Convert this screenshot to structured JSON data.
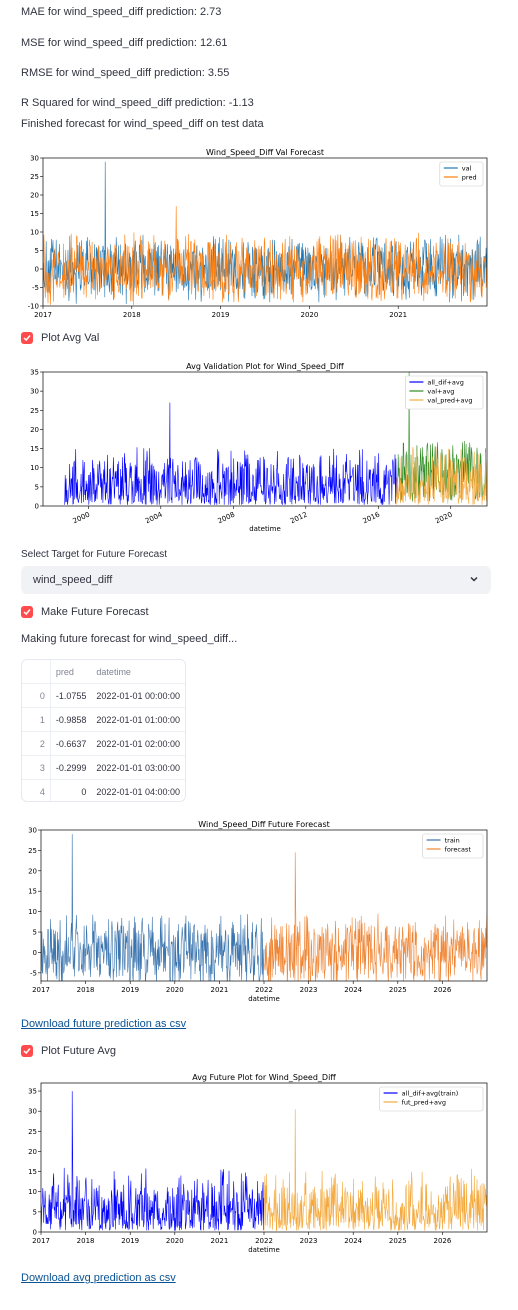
{
  "metrics": {
    "mae": "MAE for wind_speed_diff prediction: 2.73",
    "mse": "MSE for wind_speed_diff prediction: 12.61",
    "rmse": "RMSE for wind_speed_diff prediction: 3.55",
    "r2": "R Squared for wind_speed_diff prediction: -1.13",
    "finished": "Finished forecast for wind_speed_diff on test data"
  },
  "checkboxes": {
    "plot_avg_val": "Plot Avg Val",
    "make_future": "Make Future Forecast",
    "plot_future_avg": "Plot Future Avg"
  },
  "select": {
    "label": "Select Target for Future Forecast",
    "value": "wind_speed_diff"
  },
  "making_text": "Making future forecast for wind_speed_diff...",
  "table": {
    "columns": [
      "",
      "pred",
      "datetime"
    ],
    "rows": [
      [
        "0",
        "-1.0755",
        "2022-01-01 00:00:00"
      ],
      [
        "1",
        "-0.9858",
        "2022-01-01 01:00:00"
      ],
      [
        "2",
        "-0.6637",
        "2022-01-01 02:00:00"
      ],
      [
        "3",
        "-0.2999",
        "2022-01-01 03:00:00"
      ],
      [
        "4",
        "0",
        "2022-01-01 04:00:00"
      ]
    ]
  },
  "links": {
    "download_future": "Download future prediction as csv",
    "download_avg": "Download avg prediction as csv"
  },
  "chart_data": [
    {
      "type": "line",
      "title": "Wind_Speed_Diff Val Forecast",
      "xlabel": "",
      "xticks": [
        "2017",
        "2018",
        "2019",
        "2020",
        "2021"
      ],
      "xlim": [
        2017,
        2022
      ],
      "ylim": [
        -10,
        30
      ],
      "yticks": [
        -10,
        -5,
        0,
        5,
        10,
        15,
        20,
        25,
        30
      ],
      "legend": "top-right",
      "series": [
        {
          "name": "val",
          "color": "#1f77b4",
          "x_range": [
            2017,
            2022
          ],
          "spikes": [
            [
              2017.7,
              29
            ]
          ]
        },
        {
          "name": "pred",
          "color": "#ff7f0e",
          "x_range": [
            2017,
            2022
          ],
          "spikes": [
            [
              2018.5,
              17
            ]
          ]
        }
      ]
    },
    {
      "type": "line",
      "title": "Avg Validation Plot for Wind_Speed_Diff",
      "xlabel": "datetime",
      "xticks": [
        "2000",
        "2004",
        "2008",
        "2012",
        "2016",
        "2020"
      ],
      "xlim": [
        1997.5,
        2022
      ],
      "ylim": [
        0,
        35
      ],
      "yticks": [
        0,
        5,
        10,
        15,
        20,
        25,
        30,
        35
      ],
      "legend": "top-right",
      "series": [
        {
          "name": "all_dif+avg",
          "color": "#0000ff",
          "x_range": [
            1998.7,
            2017
          ],
          "spikes": [
            [
              2004.5,
              27
            ]
          ]
        },
        {
          "name": "val+avg",
          "color": "#2e8b22",
          "x_range": [
            2017,
            2022
          ],
          "spikes": [
            [
              2017.7,
              35
            ]
          ]
        },
        {
          "name": "val_pred+avg",
          "color": "#f4a93c",
          "x_range": [
            2017,
            2022
          ],
          "spikes": []
        }
      ]
    },
    {
      "type": "line",
      "title": "Wind_Speed_Diff Future Forecast",
      "xlabel": "datetime",
      "xticks": [
        "2017",
        "2018",
        "2019",
        "2020",
        "2021",
        "2022",
        "2023",
        "2024",
        "2025",
        "2026"
      ],
      "xlim": [
        2017,
        2027
      ],
      "ylim": [
        -7,
        30
      ],
      "yticks": [
        -5,
        0,
        5,
        10,
        15,
        20,
        25,
        30
      ],
      "legend": "top-right",
      "series": [
        {
          "name": "train",
          "color": "#3b75af",
          "x_range": [
            2017,
            2022
          ],
          "spikes": [
            [
              2017.7,
              29
            ]
          ]
        },
        {
          "name": "forecast",
          "color": "#ef8636",
          "x_range": [
            2022,
            2027
          ],
          "spikes": [
            [
              2022.7,
              24.5
            ]
          ]
        }
      ]
    },
    {
      "type": "line",
      "title": "Avg Future Plot for Wind_Speed_Diff",
      "xlabel": "datetime",
      "xticks": [
        "2017",
        "2018",
        "2019",
        "2020",
        "2021",
        "2022",
        "2023",
        "2024",
        "2025",
        "2026"
      ],
      "xlim": [
        2017,
        2027
      ],
      "ylim": [
        0,
        37
      ],
      "yticks": [
        0,
        5,
        10,
        15,
        20,
        25,
        30,
        35
      ],
      "legend": "top-right",
      "series": [
        {
          "name": "all_dif+avg(train)",
          "color": "#0000ff",
          "x_range": [
            2017,
            2022
          ],
          "spikes": [
            [
              2017.7,
              35
            ]
          ]
        },
        {
          "name": "fut_pred+avg",
          "color": "#f4a93c",
          "x_range": [
            2022,
            2027
          ],
          "spikes": [
            [
              2022.7,
              30.5
            ]
          ]
        }
      ]
    }
  ]
}
